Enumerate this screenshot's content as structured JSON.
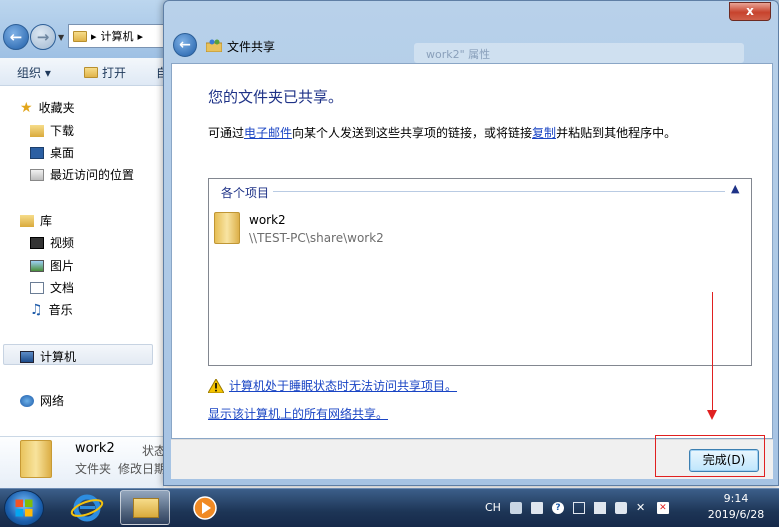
{
  "explorer": {
    "address_crumb": "计算机",
    "toolbar": {
      "organize": "组织",
      "open": "打开",
      "partial": "自"
    },
    "sidebar": {
      "favorites": "收藏夹",
      "downloads": "下载",
      "desktop": "桌面",
      "recent": "最近访问的位置",
      "libraries": "库",
      "videos": "视频",
      "pictures": "图片",
      "documents": "文档",
      "music": "音乐",
      "computer": "计算机",
      "network": "网络"
    },
    "details": {
      "name": "work2",
      "type": "文件夹",
      "status_label": "状态",
      "modified_label": "修改日期"
    }
  },
  "dialog": {
    "title": "文件共享",
    "close_label": "x",
    "ghost_text": "work2\" 属性",
    "heading": "您的文件夹已共享。",
    "desc_prefix": "可通过",
    "email_link": "电子邮件",
    "desc_middle": "向某个人发送到这些共享项的链接，或将链接",
    "copy_link": "复制",
    "desc_suffix": "并粘贴到其他程序中。",
    "group_label": "各个项目",
    "item": {
      "name": "work2",
      "path": "\\\\TEST-PC\\share\\work2"
    },
    "warning_link": "计算机处于睡眠状态时无法访问共享项目。",
    "show_shares_link": "显示该计算机上的所有网络共享。",
    "done_button": "完成(D)"
  },
  "taskbar": {
    "lang": "CH",
    "time": "9:14",
    "date": "2019/6/28"
  },
  "colors": {
    "link": "#1a45c4",
    "heading": "#1e3287",
    "annotation": "#e02020"
  }
}
